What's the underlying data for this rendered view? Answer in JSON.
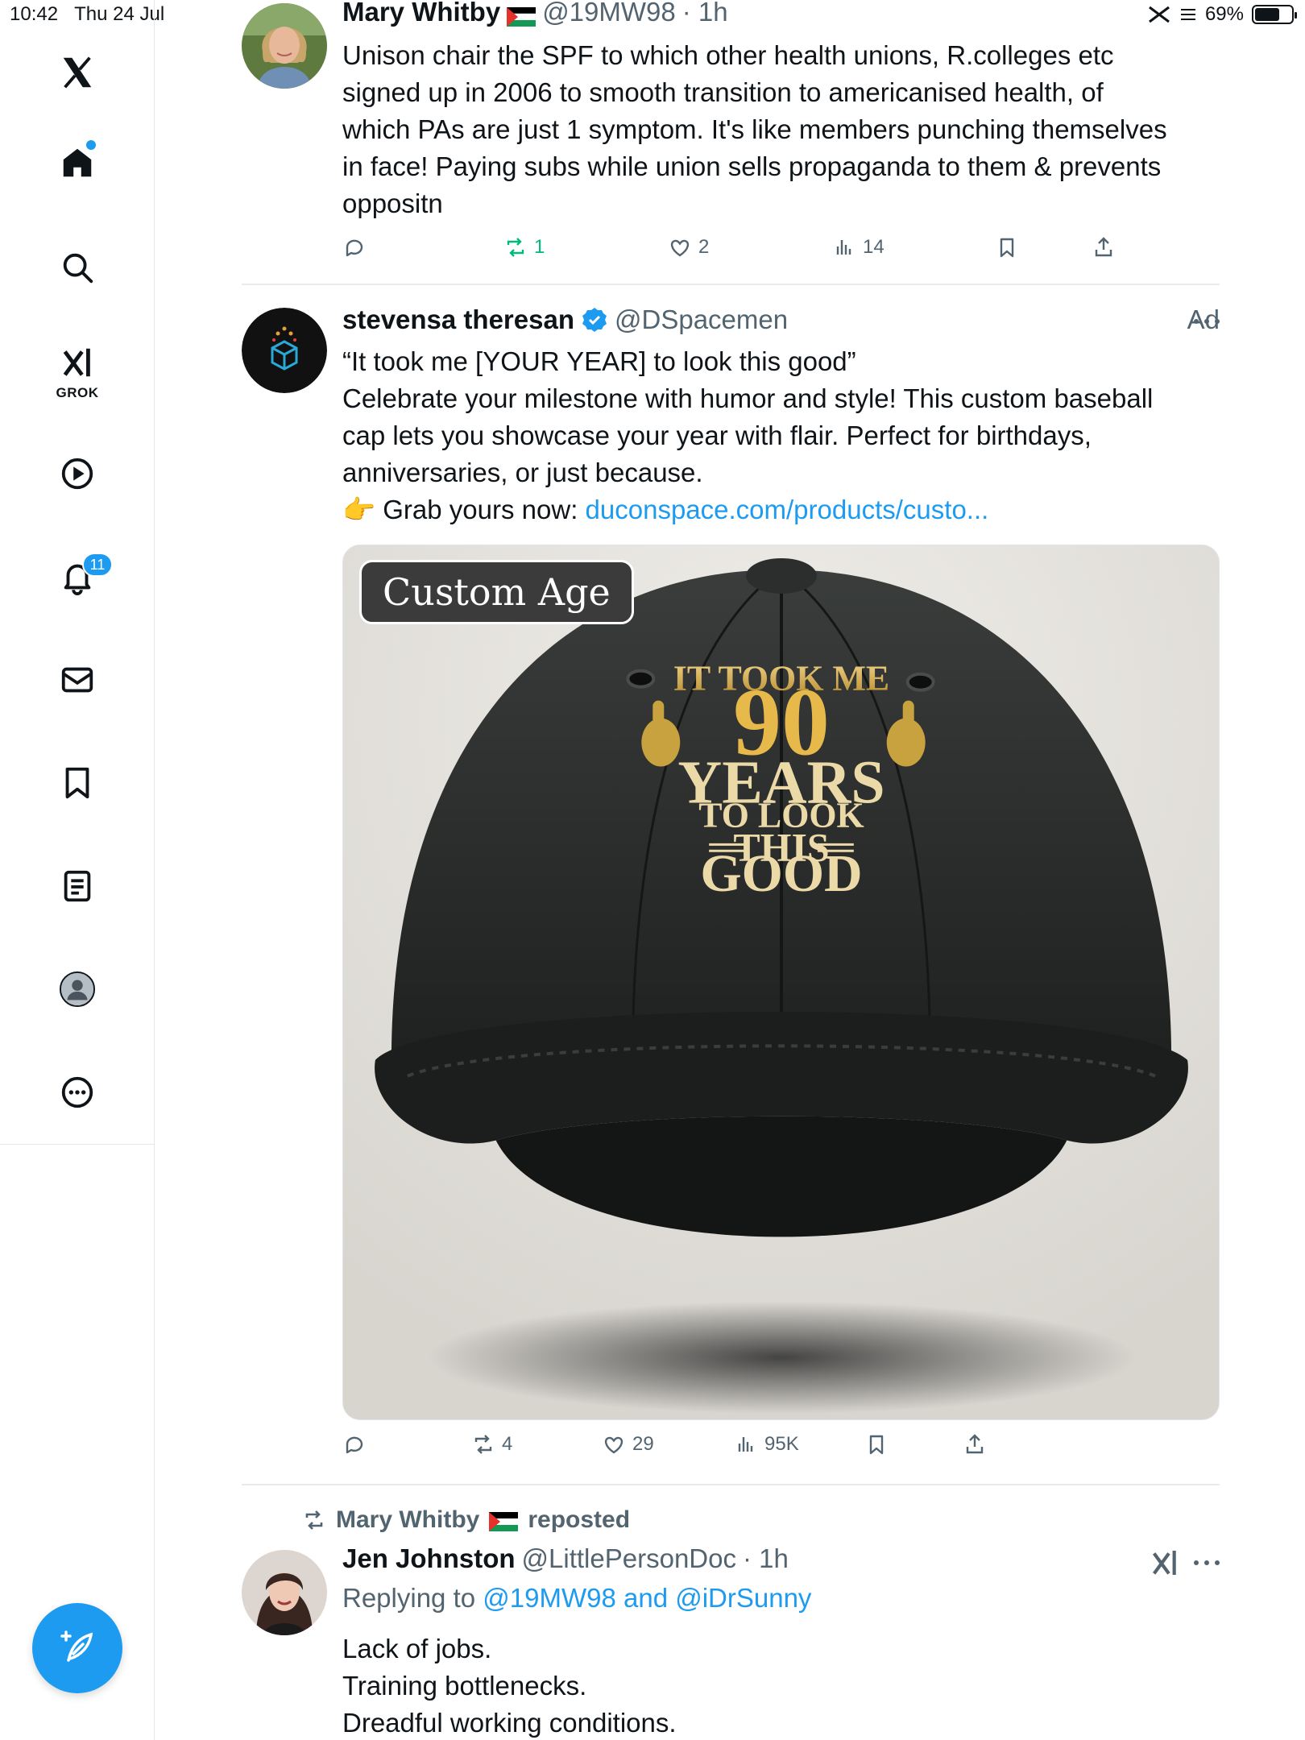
{
  "status_bar": {
    "time": "10:42",
    "date": "Thu 24 Jul",
    "battery": "69%",
    "battery_level": 0.69
  },
  "sidebar": {
    "items": [
      {
        "name": "x-logo",
        "icon": "x-logo-icon"
      },
      {
        "name": "home",
        "icon": "home-icon",
        "has_dot": true
      },
      {
        "name": "search",
        "icon": "search-icon"
      },
      {
        "name": "grok",
        "icon": "grok-icon",
        "label": "GROK"
      },
      {
        "name": "video",
        "icon": "play-icon"
      },
      {
        "name": "notifications",
        "icon": "bell-icon",
        "badge": "11"
      },
      {
        "name": "messages",
        "icon": "mail-icon"
      },
      {
        "name": "bookmarks",
        "icon": "bookmark-icon"
      },
      {
        "name": "lists",
        "icon": "list-icon"
      },
      {
        "name": "profile",
        "icon": "profile-icon"
      },
      {
        "name": "more",
        "icon": "more-circle-icon"
      }
    ],
    "compose_icon": "compose-icon"
  },
  "posts": [
    {
      "name": "Mary Whitby",
      "handle": "@19MW98",
      "time": "· 1h",
      "text_lines": [
        "Unison chair the SPF to which other health unions, R.colleges etc",
        "signed up in 2006 to smooth transition to americanised health, of",
        "which PAs are just 1 symptom. It's like members punching themselves",
        "in face! Paying subs while union sells propaganda to them & prevents",
        "oppositn"
      ],
      "actions": {
        "reply": "",
        "repost": "1",
        "like": "2",
        "views": "14"
      }
    },
    {
      "name": "stevensa theresan",
      "handle": "@DSpacemen",
      "ad_label": "Ad",
      "text_lines": [
        "“It took me [YOUR YEAR] to look this good”",
        "Celebrate your milestone with humor and style! This custom baseball",
        "cap lets you showcase your year with flair. Perfect for birthdays,",
        "anniversaries, or just because."
      ],
      "grab_prefix": "👉 Grab yours now: ",
      "link": "duconspace.com/products/custo...",
      "media": {
        "badge": "Custom Age",
        "cap_text": [
          "IT TOOK ME",
          "90",
          "YEARS",
          "TO LOOK",
          "THIS",
          "GOOD"
        ]
      },
      "actions": {
        "reply": "",
        "repost": "4",
        "like": "29",
        "views": "95K"
      }
    },
    {
      "repost_by": "Mary Whitby",
      "repost_suffix": "reposted",
      "name": "Jen Johnston",
      "handle": "@LittlePersonDoc",
      "time": "· 1h",
      "replying_prefix": "Replying to ",
      "replying_to": "@19MW98 and @iDrSunny",
      "text_lines": [
        "Lack of jobs.",
        "Training bottlenecks.",
        "Dreadful working conditions."
      ]
    }
  ]
}
